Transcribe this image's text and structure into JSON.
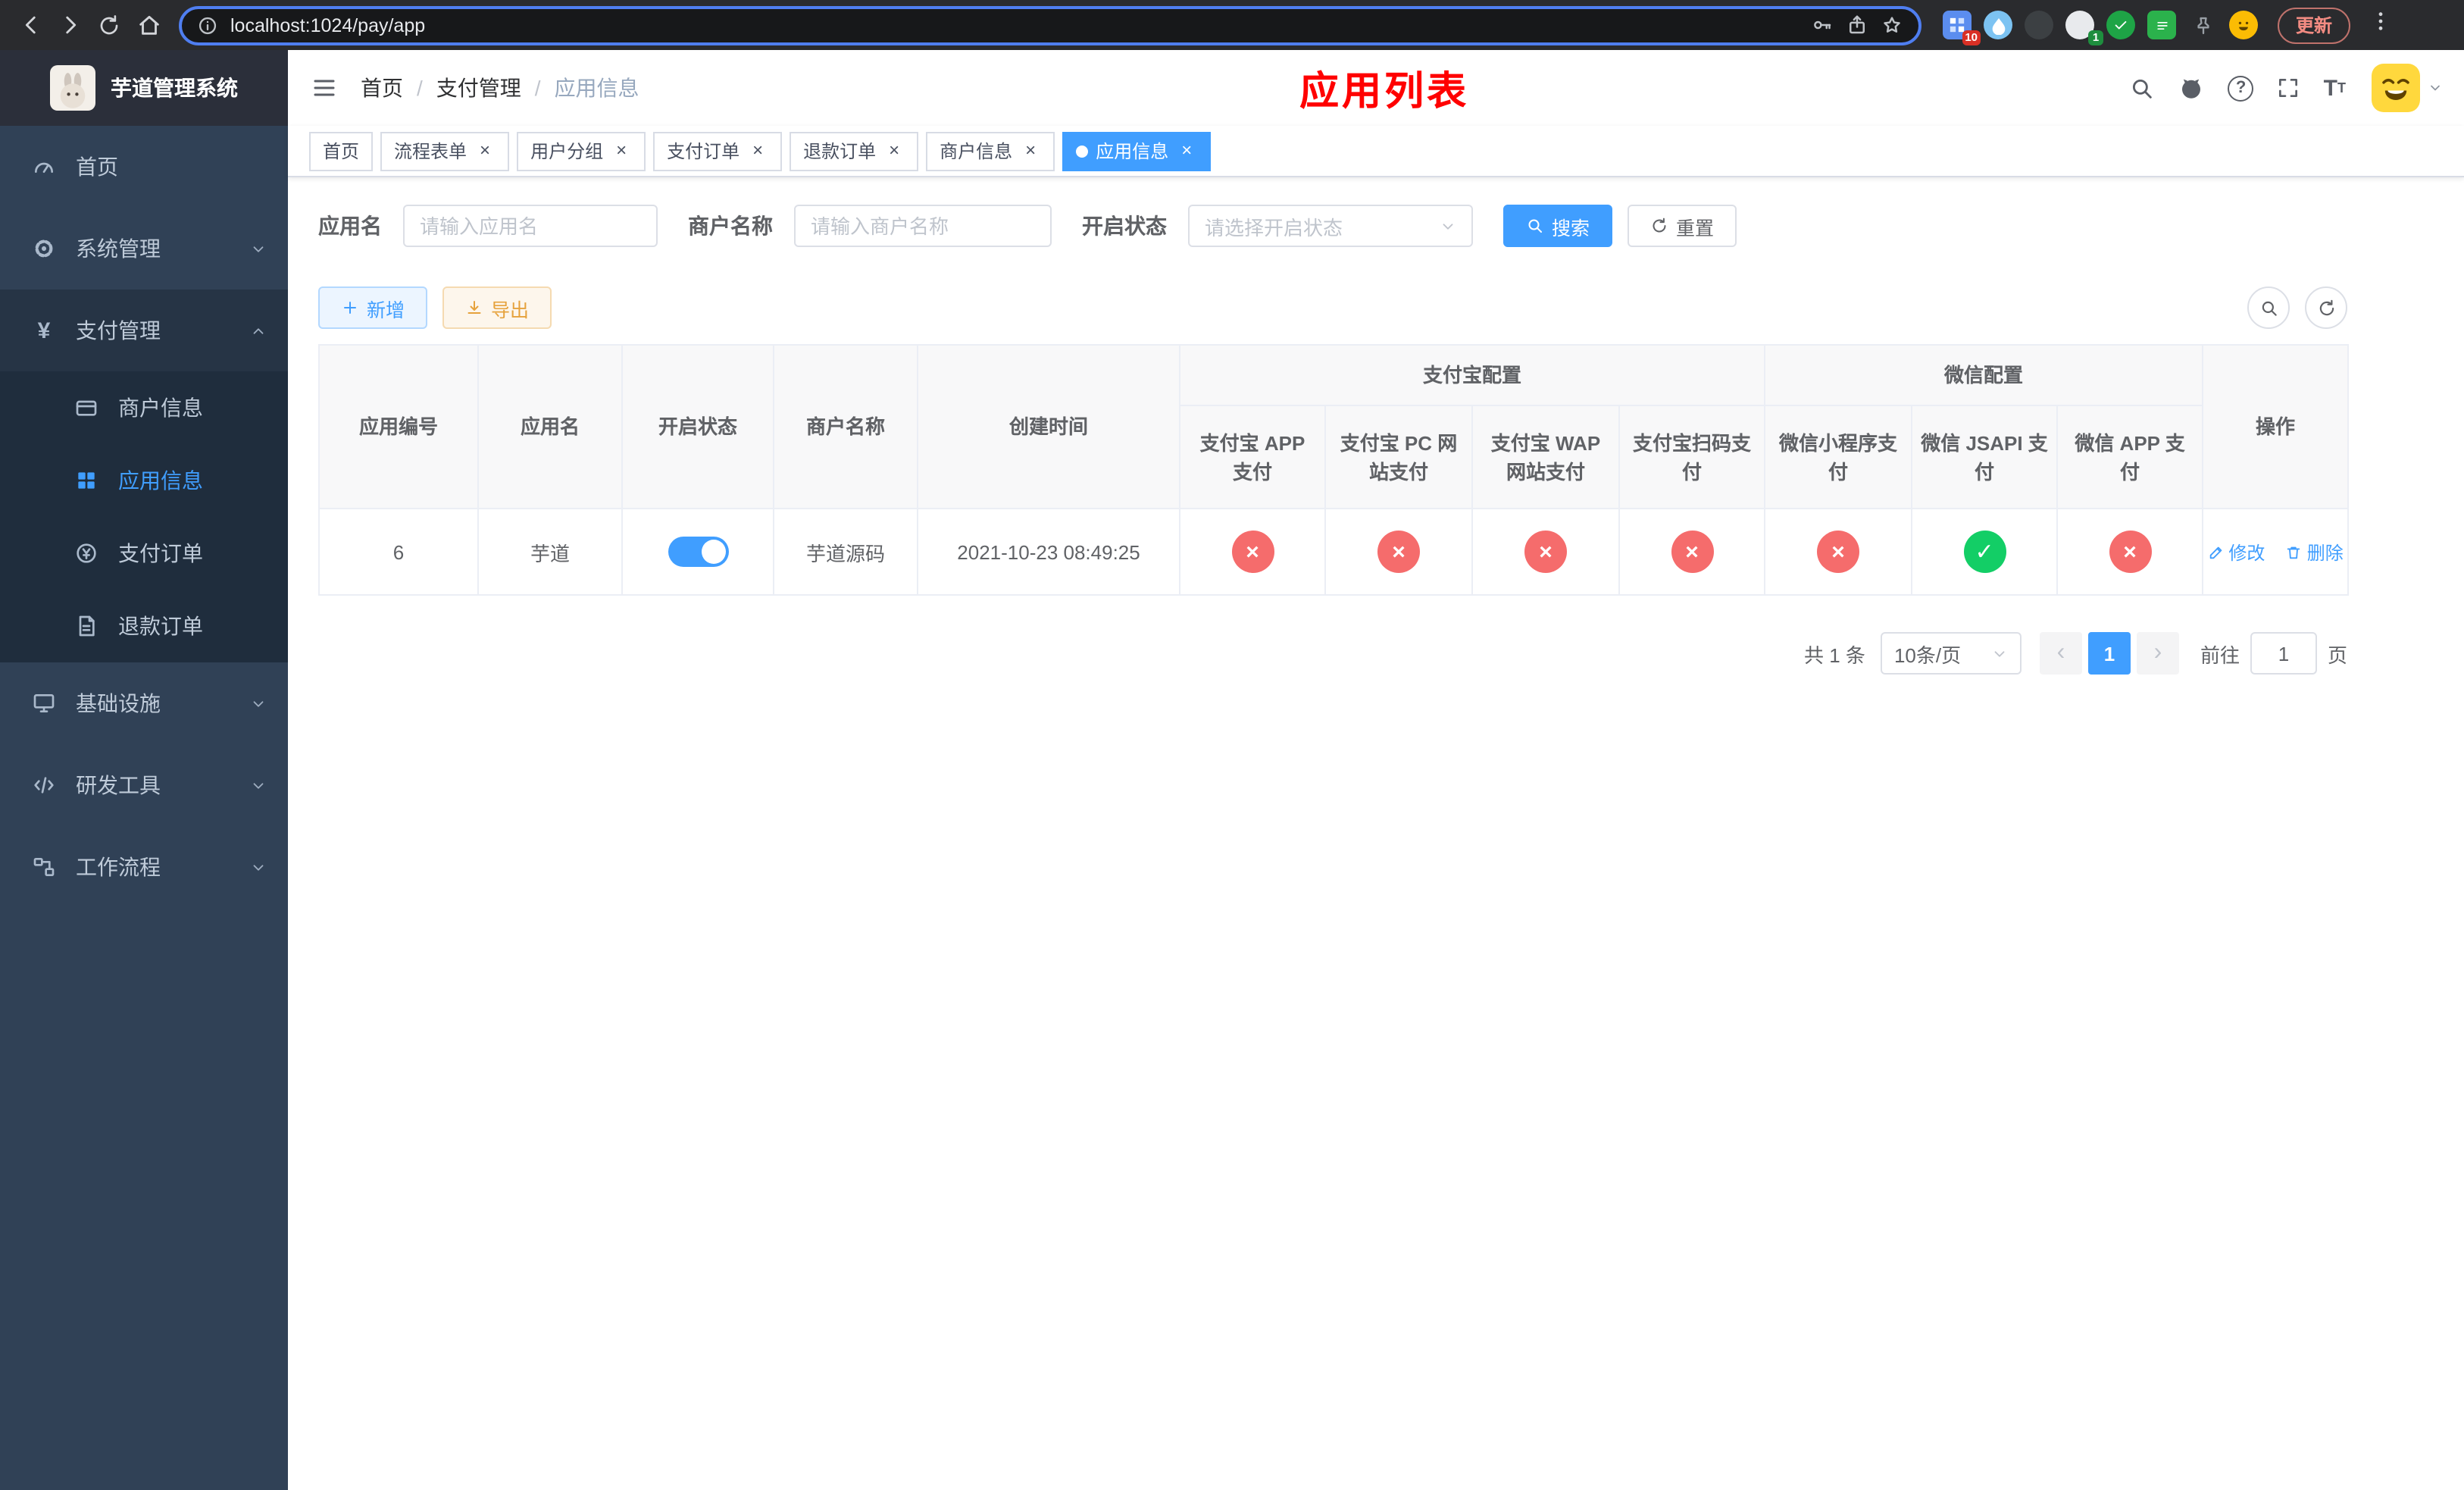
{
  "browser": {
    "url": "localhost:1024/pay/app",
    "update_button": "更新",
    "ext_badge_10": "10",
    "ext_badge_1": "1"
  },
  "sidebar": {
    "title": "芋道管理系统",
    "menu_home": "首页",
    "menu_system": "系统管理",
    "menu_payment": "支付管理",
    "menu_merchant_info": "商户信息",
    "menu_app_info": "应用信息",
    "menu_pay_order": "支付订单",
    "menu_refund_order": "退款订单",
    "menu_infra": "基础设施",
    "menu_dev_tools": "研发工具",
    "menu_workflow": "工作流程",
    "payment_icon_glyph": "¥"
  },
  "header": {
    "breadcrumb_home": "首页",
    "breadcrumb_section": "支付管理",
    "breadcrumb_current": "应用信息",
    "separator": "/",
    "page_title": "应用列表"
  },
  "tabs": [
    {
      "label": "首页"
    },
    {
      "label": "流程表单"
    },
    {
      "label": "用户分组"
    },
    {
      "label": "支付订单"
    },
    {
      "label": "退款订单"
    },
    {
      "label": "商户信息"
    },
    {
      "label": "应用信息"
    }
  ],
  "tab_close_glyph": "×",
  "filters": {
    "app_name_label": "应用名",
    "app_name_placeholder": "请输入应用名",
    "merchant_label": "商户名称",
    "merchant_placeholder": "请输入商户名称",
    "status_label": "开启状态",
    "status_placeholder": "请选择开启状态",
    "search_button": "搜索",
    "reset_button": "重置"
  },
  "toolbar": {
    "add_button": "新增",
    "export_button": "导出"
  },
  "table": {
    "group_alipay": "支付宝配置",
    "group_wechat": "微信配置",
    "col_app_id": "应用编号",
    "col_app_name": "应用名",
    "col_status": "开启状态",
    "col_merchant_name": "商户名称",
    "col_created_at": "创建时间",
    "col_alipay_app": "支付宝 APP 支付",
    "col_alipay_pc": "支付宝 PC 网站支付",
    "col_alipay_wap": "支付宝 WAP 网站支付",
    "col_alipay_qr": "支付宝扫码支付",
    "col_wechat_mini": "微信小程序支付",
    "col_wechat_jsapi": "微信 JSAPI 支付",
    "col_wechat_app": "微信 APP 支付",
    "col_actions": "操作",
    "fail_glyph": "×",
    "ok_glyph": "✓",
    "rows": [
      {
        "app_id": "6",
        "app_name": "芋道",
        "status": "on",
        "merchant_name": "芋道源码",
        "created_at": "2021-10-23 08:49:25",
        "alipay_app": "fail",
        "alipay_pc": "fail",
        "alipay_wap": "fail",
        "alipay_qr": "fail",
        "wechat_mini": "fail",
        "wechat_jsapi": "success",
        "wechat_app": "fail",
        "edit_label": "修改",
        "delete_label": "删除"
      }
    ]
  },
  "pagination": {
    "total_text": "共 1 条",
    "page_size": "10条/页",
    "prev_glyph": "‹",
    "next_glyph": "›",
    "current_page": "1",
    "goto_label": "前往",
    "goto_value": "1",
    "page_unit": "页"
  },
  "colors": {
    "primary": "#409eff",
    "success": "#13ce66",
    "danger": "#f56c6c",
    "warning": "#e6a23c",
    "sidebar_bg": "#304156",
    "submenu_bg": "#1f2d3d",
    "title_red": "#ff0000"
  }
}
